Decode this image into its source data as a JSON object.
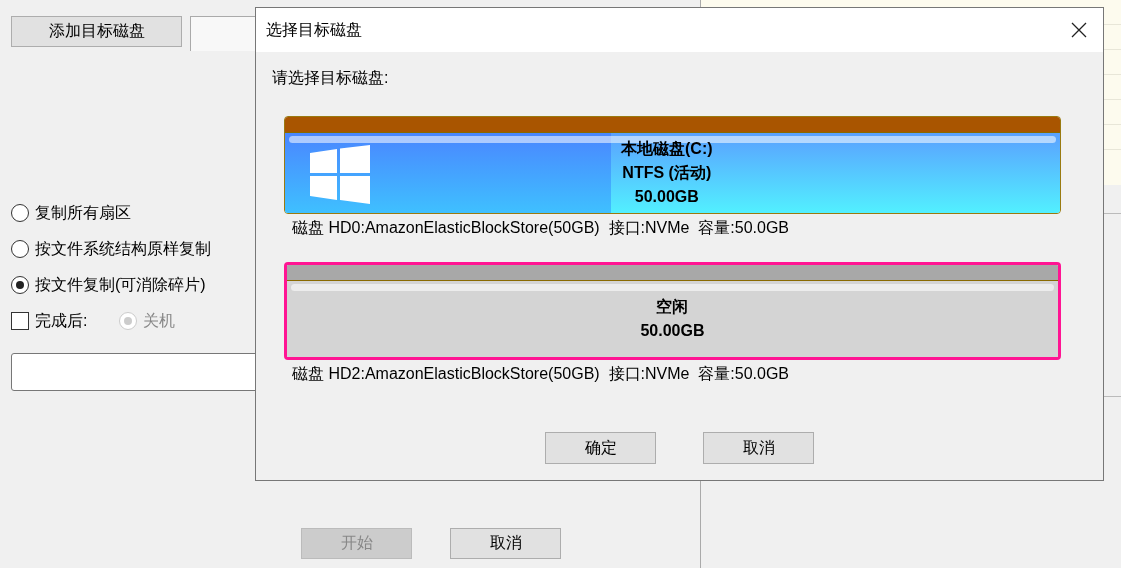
{
  "main": {
    "add_button": "添加目标磁盘",
    "copy_modes": [
      {
        "label": "复制所有扇区",
        "selected": false
      },
      {
        "label": "按文件系统结构原样复制",
        "selected": false
      },
      {
        "label": "按文件复制(可消除碎片)",
        "selected": true
      }
    ],
    "after_done": {
      "label": "完成后:",
      "checked": false
    },
    "shutdown": {
      "label": "关机",
      "selected": true,
      "disabled": true
    },
    "buttons": [
      {
        "label": "开始",
        "disabled": true
      },
      {
        "label": "取消",
        "disabled": false
      }
    ]
  },
  "dialog": {
    "title": "选择目标磁盘",
    "prompt": "请选择目标磁盘:",
    "disks": [
      {
        "selected": false,
        "kind": "partition",
        "lines": [
          "本地磁盘(C:)",
          "NTFS (活动)",
          "50.00GB"
        ],
        "level": 0.42,
        "info": "磁盘 HD0:AmazonElasticBlockStore(50GB)  接口:NVMe  容量:50.0GB"
      },
      {
        "selected": true,
        "kind": "free",
        "lines": [
          "空闲",
          "50.00GB"
        ],
        "info": "磁盘 HD2:AmazonElasticBlockStore(50GB)  接口:NVMe  容量:50.0GB"
      }
    ],
    "buttons": [
      "确定",
      "取消"
    ]
  }
}
